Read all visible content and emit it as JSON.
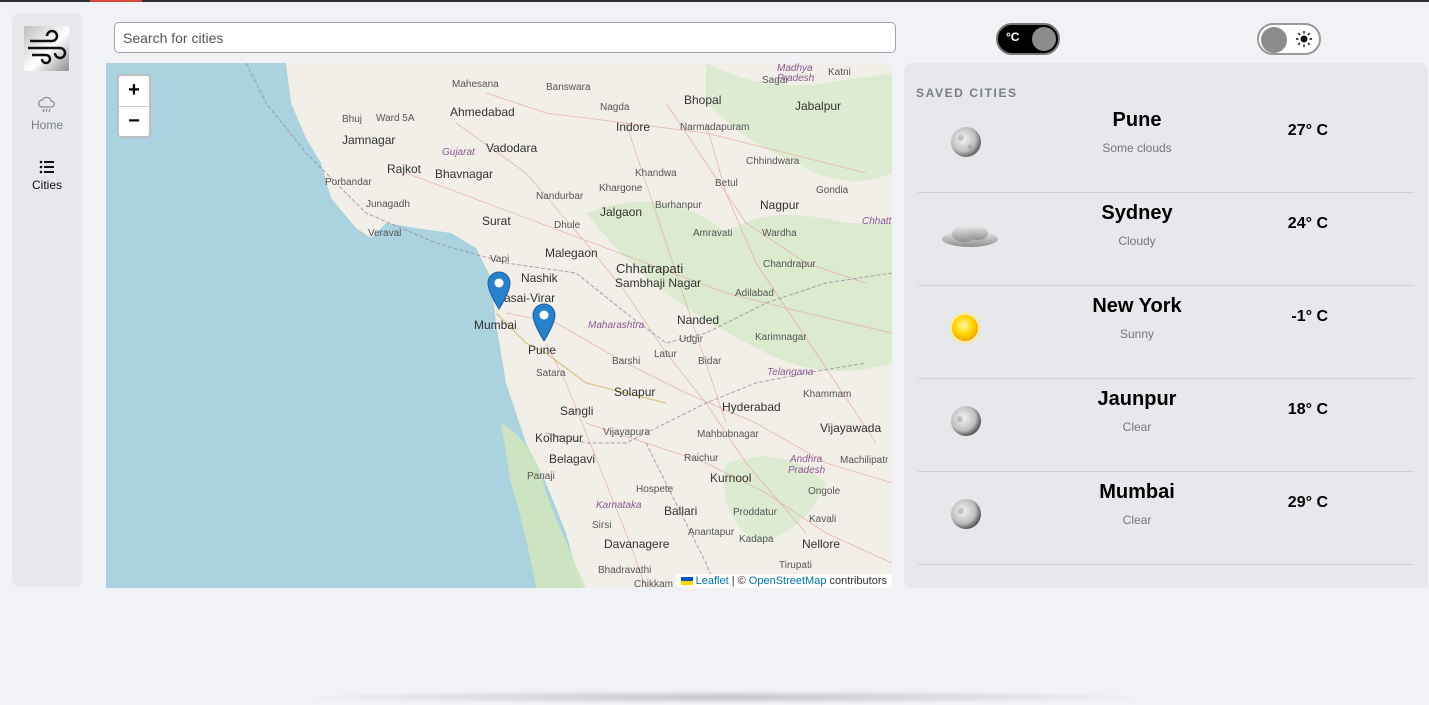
{
  "search": {
    "placeholder": "Search for cities",
    "value": ""
  },
  "nav": [
    {
      "label": "Home",
      "icon": "cloud-rain-icon"
    },
    {
      "label": "Cities",
      "icon": "list-icon",
      "active": true
    }
  ],
  "unit_toggle": {
    "label": "°C"
  },
  "theme_toggle": {
    "icon": "sun-icon"
  },
  "map": {
    "zoom_in": "+",
    "zoom_out": "−",
    "places": [
      "Mahesana",
      "Banswara",
      "Sagar",
      "Katni",
      "Bhopal",
      "Jabalpur",
      "Ahmedabad",
      "Nagda",
      "Bhuj",
      "Ward 5A",
      "Indore",
      "Narmadapuram",
      "Jamnagar",
      "Vadodara",
      "Gujarat",
      "Rajkot",
      "Bhavnagar",
      "Chhindwara",
      "Khandwa",
      "Porbandar",
      "Khargone",
      "Betul",
      "Gondia",
      "Junagadh",
      "Nandurbar",
      "Burhanpur",
      "Nagpur",
      "Surat",
      "Jalgaon",
      "Veraval",
      "Dhule",
      "Amravati",
      "Wardha",
      "Chhatt",
      "Malegaon",
      "Vapi",
      "Chhatrapati",
      "Nashik",
      "Sambhaji Nagar",
      "Chandrapur",
      "asai-Virar",
      "Adilabad",
      "Mumbai",
      "Maharashtra",
      "Nanded",
      "Pune",
      "Udgir",
      "Karimnagar",
      "Latur",
      "Barshi",
      "Bidar",
      "Satara",
      "Telangana",
      "Solapur",
      "Khammam",
      "Sangli",
      "Hyderabad",
      "Vijayapura",
      "Kolhapur",
      "Mahbubnagar",
      "Vijayawada",
      "Belagavi",
      "Raichur",
      "Andhra",
      "Pradesh",
      "Machilipatr",
      "Panaji",
      "Kurnool",
      "Hospete",
      "Ongole",
      "Karnataka",
      "Ballari",
      "Proddatur",
      "Sirsi",
      "Kavali",
      "Anantapur",
      "Kadapa",
      "Nellore",
      "Davanagere",
      "Tirupati",
      "Bhadravathi",
      "Chikkam",
      "Madhya",
      "Pradesh"
    ],
    "attribution": {
      "leaflet": "Leaflet",
      "sep": "| ©",
      "osm": "OpenStreetMap",
      "suffix": "contributors"
    }
  },
  "saved_cities": {
    "heading": "SAVED CITIES",
    "items": [
      {
        "name": "Pune",
        "desc": "Some clouds",
        "temp": "27° C",
        "icon": "moon-icon"
      },
      {
        "name": "Sydney",
        "desc": "Cloudy",
        "temp": "24° C",
        "icon": "cloud-icon"
      },
      {
        "name": "New York",
        "desc": "Sunny",
        "temp": "-1° C",
        "icon": "sun-icon"
      },
      {
        "name": "Jaunpur",
        "desc": "Clear",
        "temp": "18° C",
        "icon": "moon-icon"
      },
      {
        "name": "Mumbai",
        "desc": "Clear",
        "temp": "29° C",
        "icon": "moon-icon"
      }
    ]
  }
}
